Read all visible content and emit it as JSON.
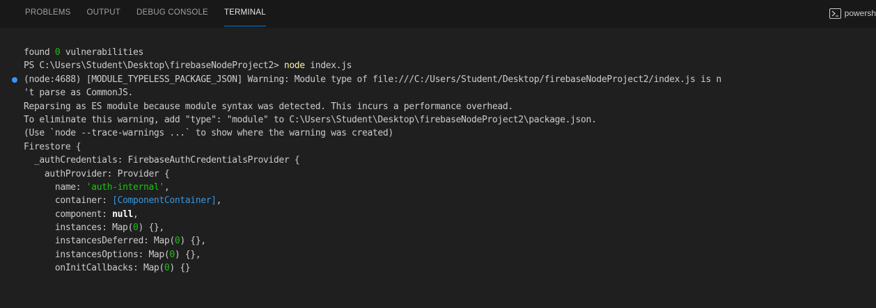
{
  "panel": {
    "tabs": [
      {
        "label": "PROBLEMS",
        "active": false
      },
      {
        "label": "OUTPUT",
        "active": false
      },
      {
        "label": "DEBUG CONSOLE",
        "active": false
      },
      {
        "label": "TERMINAL",
        "active": true
      }
    ],
    "shell_label": "powersh",
    "shell_icon": "terminal-icon"
  },
  "colors": {
    "background": "#1f1f1f",
    "text": "#cccccc",
    "green": "#16c60c",
    "yellow": "#f9f1a5",
    "blue": "#3a96dd",
    "accent": "#0078d4",
    "decoration_dot": "#3794ff"
  },
  "terminal": {
    "lines": [
      {
        "dot": false,
        "segments": [
          [
            "found ",
            ""
          ],
          [
            "0",
            "num"
          ],
          [
            " vulnerabilities",
            ""
          ]
        ]
      },
      {
        "dot": false,
        "segments": [
          [
            "PS C:\\Users\\Student\\Desktop\\firebaseNodeProject2> ",
            ""
          ],
          [
            "node",
            "cmd"
          ],
          [
            " index.js",
            ""
          ]
        ]
      },
      {
        "dot": true,
        "segments": [
          [
            "(node:4688) [MODULE_TYPELESS_PACKAGE_JSON] Warning: Module type of file:///C:/Users/Student/Desktop/firebaseNodeProject2/index.js is n",
            ""
          ]
        ]
      },
      {
        "dot": false,
        "segments": [
          [
            "'t parse as CommonJS.",
            ""
          ]
        ]
      },
      {
        "dot": false,
        "segments": [
          [
            "Reparsing as ES module because module syntax was detected. This incurs a performance overhead.",
            ""
          ]
        ]
      },
      {
        "dot": false,
        "segments": [
          [
            "To eliminate this warning, add \"type\": \"module\" to C:\\Users\\Student\\Desktop\\firebaseNodeProject2\\package.json.",
            ""
          ]
        ]
      },
      {
        "dot": false,
        "segments": [
          [
            "(Use `node --trace-warnings ...` to show where the warning was created)",
            ""
          ]
        ]
      },
      {
        "dot": false,
        "segments": [
          [
            "Firestore {",
            ""
          ]
        ]
      },
      {
        "dot": false,
        "segments": [
          [
            "  _authCredentials: FirebaseAuthCredentialsProvider {",
            ""
          ]
        ]
      },
      {
        "dot": false,
        "segments": [
          [
            "    authProvider: Provider {",
            ""
          ]
        ]
      },
      {
        "dot": false,
        "segments": [
          [
            "      name: ",
            ""
          ],
          [
            "'auth-internal'",
            "str"
          ],
          [
            ",",
            ""
          ]
        ]
      },
      {
        "dot": false,
        "segments": [
          [
            "      container: ",
            ""
          ],
          [
            "[ComponentContainer]",
            "special"
          ],
          [
            ",",
            ""
          ]
        ]
      },
      {
        "dot": false,
        "segments": [
          [
            "      component: ",
            ""
          ],
          [
            "null",
            "bold"
          ],
          [
            ",",
            ""
          ]
        ]
      },
      {
        "dot": false,
        "segments": [
          [
            "      instances: Map(",
            ""
          ],
          [
            "0",
            "num"
          ],
          [
            ") {},",
            ""
          ]
        ]
      },
      {
        "dot": false,
        "segments": [
          [
            "      instancesDeferred: Map(",
            ""
          ],
          [
            "0",
            "num"
          ],
          [
            ") {},",
            ""
          ]
        ]
      },
      {
        "dot": false,
        "segments": [
          [
            "      instancesOptions: Map(",
            ""
          ],
          [
            "0",
            "num"
          ],
          [
            ") {},",
            ""
          ]
        ]
      },
      {
        "dot": false,
        "segments": [
          [
            "      onInitCallbacks: Map(",
            ""
          ],
          [
            "0",
            "num"
          ],
          [
            ") {}",
            ""
          ]
        ]
      }
    ]
  }
}
